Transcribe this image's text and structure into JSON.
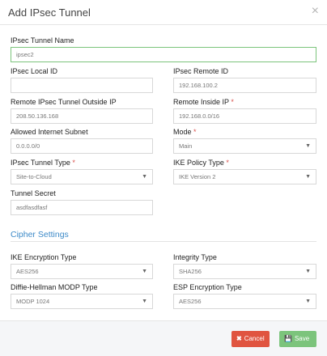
{
  "modal": {
    "title": "Add IPsec Tunnel",
    "close": "×"
  },
  "fields": {
    "tunnel_name": {
      "label": "IPsec Tunnel Name",
      "value": "ipsec2"
    },
    "local_id": {
      "label": "IPsec Local ID",
      "value": ""
    },
    "remote_id": {
      "label": "IPsec Remote ID",
      "value": "192.168.100.2"
    },
    "remote_outside_ip": {
      "label": "Remote IPsec Tunnel Outside IP",
      "value": "208.50.136.168"
    },
    "remote_inside_ip": {
      "label": "Remote Inside IP",
      "value": "192.168.0.0/16",
      "required": "*"
    },
    "allowed_subnet": {
      "label": "Allowed Internet Subnet",
      "value": "0.0.0.0/0"
    },
    "mode": {
      "label": "Mode",
      "value": "Main",
      "required": "*"
    },
    "tunnel_type": {
      "label": "IPsec Tunnel Type",
      "value": "Site-to-Cloud",
      "required": "*"
    },
    "ike_policy": {
      "label": "IKE Policy Type",
      "value": "IKE Version 2",
      "required": "*"
    },
    "tunnel_secret": {
      "label": "Tunnel Secret",
      "value": "asdfasdfasf"
    }
  },
  "cipher": {
    "heading": "Cipher Settings",
    "ike_encryption": {
      "label": "IKE Encryption Type",
      "value": "AES256"
    },
    "integrity": {
      "label": "Integrity Type",
      "value": "SHA256"
    },
    "dh_modp": {
      "label": "Diffie-Hellman MODP Type",
      "value": "MODP 1024"
    },
    "esp_encryption": {
      "label": "ESP Encryption Type",
      "value": "AES256"
    }
  },
  "footer": {
    "cancel_label": "Cancel",
    "save_label": "Save"
  },
  "icons": {
    "select_arrow": "▼",
    "cancel_icon": "✖",
    "save_icon": "💾"
  },
  "colors": {
    "accent": "#3d8ac8",
    "cancel": "#e05440",
    "save": "#7cc47c",
    "required": "#d9534f"
  }
}
